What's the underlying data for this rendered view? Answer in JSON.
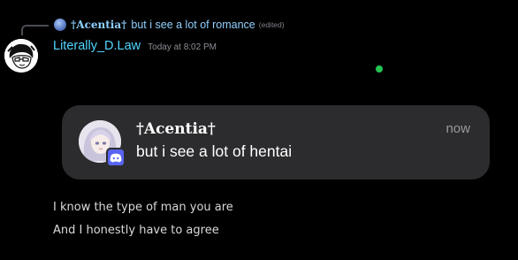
{
  "reply": {
    "author": "†Acentia†",
    "content": "but i see a lot of romance",
    "edited": "(edited)"
  },
  "message": {
    "username": "Literally_D.Law",
    "timestamp": "Today at 8:02 PM"
  },
  "notification": {
    "title": "†Acentia†",
    "body": "but i see a lot of hentai",
    "time": "now"
  },
  "captions": [
    "I know the type of man you are",
    "And I honestly have to agree"
  ],
  "colors": {
    "accent_name": "#4fd8ff",
    "reply_text": "#8fd0ff",
    "online": "#23c552",
    "discord": "#5865f2",
    "card_bg": "#2c2c2e"
  },
  "icons": {
    "reply_avatar": "reply-author-avatar-icon",
    "status": "online-status-icon",
    "badge": "discord-logo-icon"
  }
}
